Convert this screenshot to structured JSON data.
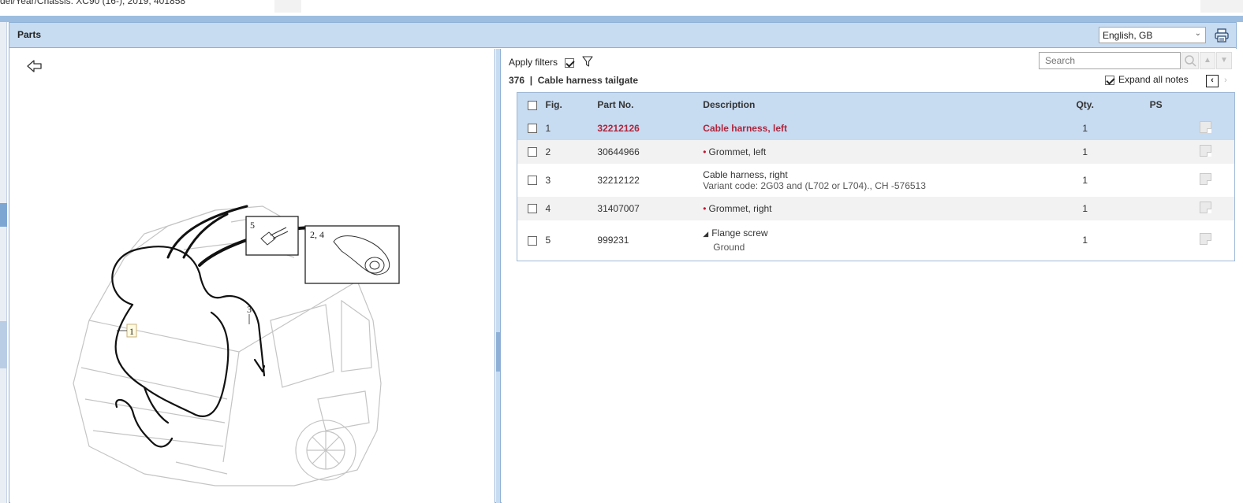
{
  "context_line": "del/Year/Chassis:  XC90 (16-), 2019, 401858",
  "frame": {
    "title": "Parts",
    "language": "English, GB"
  },
  "filters": {
    "apply_label": "Apply filters",
    "apply_checked": true
  },
  "search": {
    "placeholder": "Search"
  },
  "group": {
    "heading": "376  |  Cable harness tailgate"
  },
  "notes": {
    "expand_label": "Expand all notes",
    "expand_checked": true
  },
  "table": {
    "headers": {
      "fig": "Fig.",
      "part_no": "Part No.",
      "description": "Description",
      "qty": "Qty.",
      "ps": "PS"
    },
    "rows": [
      {
        "fig": "1",
        "part_no": "32212126",
        "description": "Cable harness, left",
        "qty": "1",
        "selected": true
      },
      {
        "fig": "2",
        "part_no": "30644966",
        "description": "Grommet, left",
        "qty": "1",
        "bullet": true
      },
      {
        "fig": "3",
        "part_no": "32212122",
        "description": "Cable harness, right",
        "variant": "Variant code: 2G03 and (L702 or L704)., CH -576513",
        "qty": "1"
      },
      {
        "fig": "4",
        "part_no": "31407007",
        "description": "Grommet, right",
        "qty": "1",
        "bullet": true
      },
      {
        "fig": "5",
        "part_no": "999231",
        "description": "Flange screw",
        "sub": "Ground",
        "qty": "1"
      }
    ]
  },
  "diagram": {
    "callout_1": "1",
    "callout_3": "3",
    "box_5_label": "5",
    "box_24_label": "2, 4"
  },
  "icons": {
    "back": "back-arrow-icon",
    "print": "printer-icon",
    "filter": "filter-icon",
    "search": "magnifier-icon",
    "note": "note-icon"
  },
  "colors": {
    "header_blue": "#c7dbf1",
    "selected_text": "#b0243a",
    "bullet_red": "#c8102e"
  }
}
